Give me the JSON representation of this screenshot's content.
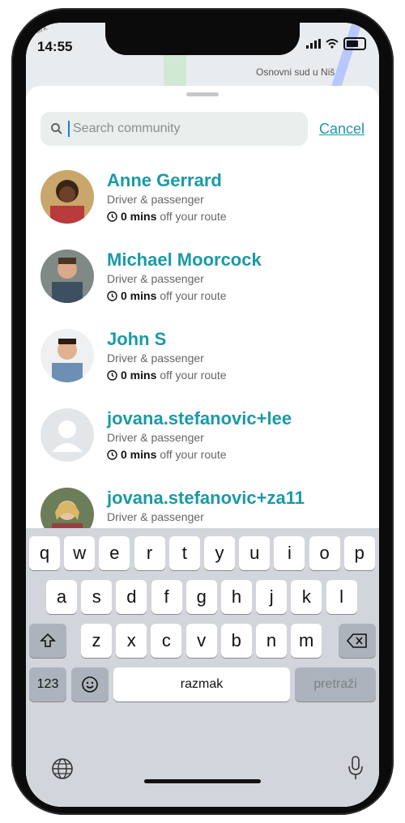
{
  "status": {
    "time": "14:55"
  },
  "map": {
    "label_left": "Park",
    "label_right": "Osnovni sud u Niš"
  },
  "search": {
    "placeholder": "Search community",
    "cancel_label": "Cancel"
  },
  "people": [
    {
      "name": "Anne Gerrard",
      "role": "Driver & passenger",
      "mins": "0 mins",
      "route_suffix": "off your route"
    },
    {
      "name": "Michael Moorcock",
      "role": "Driver & passenger",
      "mins": "0 mins",
      "route_suffix": "off your route"
    },
    {
      "name": "John S",
      "role": "Driver & passenger",
      "mins": "0 mins",
      "route_suffix": "off your route"
    },
    {
      "name": "jovana.stefanovic+lee",
      "role": "Driver & passenger",
      "mins": "0 mins",
      "route_suffix": "off your route"
    },
    {
      "name": "jovana.stefanovic+za11",
      "role": "Driver & passenger"
    }
  ],
  "keyboard": {
    "row1": [
      "q",
      "w",
      "e",
      "r",
      "t",
      "y",
      "u",
      "i",
      "o",
      "p"
    ],
    "row2": [
      "a",
      "s",
      "d",
      "f",
      "g",
      "h",
      "j",
      "k",
      "l"
    ],
    "row3": [
      "z",
      "x",
      "c",
      "v",
      "b",
      "n",
      "m"
    ],
    "numbers_label": "123",
    "space_label": "razmak",
    "search_label": "pretraži"
  }
}
